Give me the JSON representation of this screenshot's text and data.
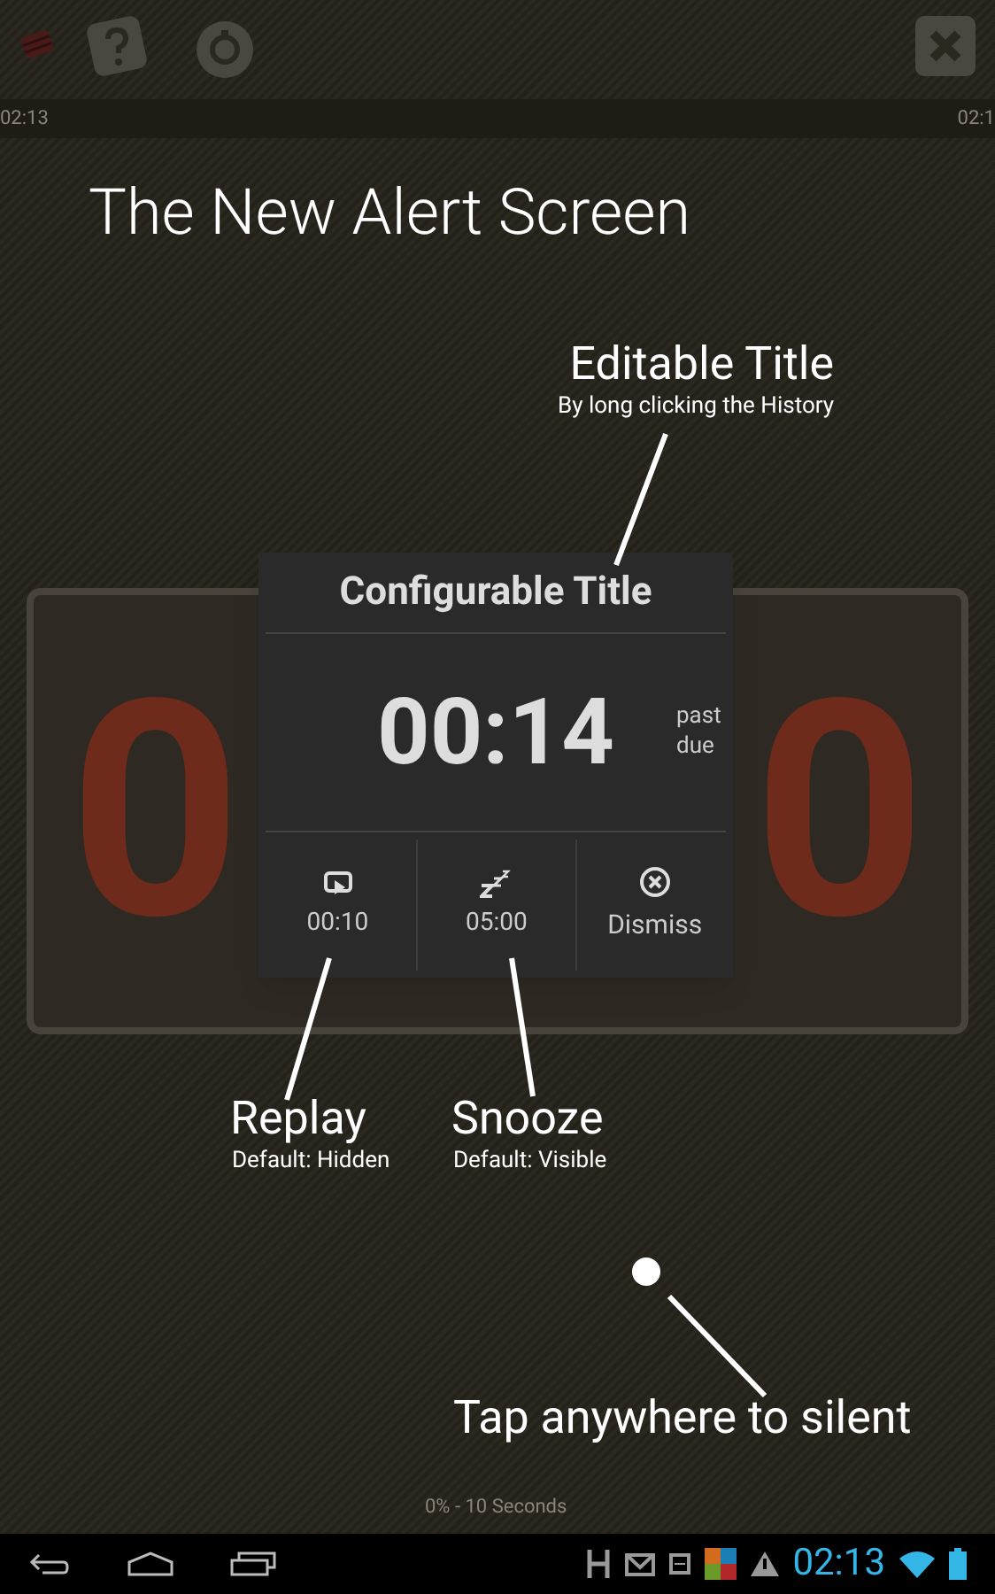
{
  "top_bar": {
    "left_time": "02:13",
    "right_time": "02:1"
  },
  "heading": "The New Alert Screen",
  "background_clock": {
    "digits": [
      "0",
      "0"
    ]
  },
  "alert": {
    "title": "Configurable Title",
    "time": "00:14",
    "suffix_line1": "past",
    "suffix_line2": "due",
    "actions": [
      {
        "kind": "replay",
        "label": "00:10"
      },
      {
        "kind": "snooze",
        "label": "05:00"
      },
      {
        "kind": "dismiss",
        "label": "Dismiss"
      }
    ]
  },
  "annotations": [
    {
      "kind": "title",
      "label": "Editable Title",
      "note": "By long clicking the History"
    },
    {
      "kind": "replay",
      "label": "Replay",
      "note": "Default: Hidden"
    },
    {
      "kind": "snooze",
      "label": "Snooze",
      "note": "Default: Visible"
    },
    {
      "kind": "tap",
      "label": "Tap anywhere to silent"
    }
  ],
  "progress_text": "0% - 10 Seconds",
  "status_bar": {
    "time": "02:13"
  }
}
